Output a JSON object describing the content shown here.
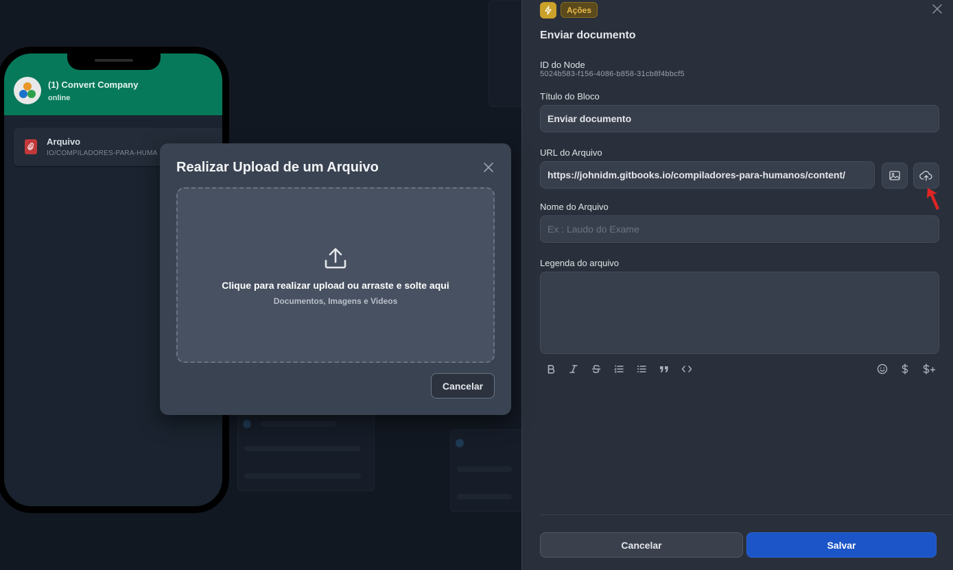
{
  "phone": {
    "contact_name": "(1) Convert Company",
    "contact_status": "online",
    "message": {
      "title": "Arquivo",
      "subtitle": "IO/COMPILADORES-PARA-HUMA"
    }
  },
  "upload_modal": {
    "title": "Realizar Upload de um Arquivo",
    "dropzone_title": "Clique para realizar upload ou arraste e solte aqui",
    "dropzone_subtitle": "Documentos, Imagens e Videos",
    "cancel_label": "Cancelar"
  },
  "panel": {
    "badge": "Ações",
    "title": "Enviar documento",
    "node_id_label": "ID do Node",
    "node_id_value": "5024b583-f156-4086-b858-31cb8f4bbcf5",
    "block_title_label": "Título do Bloco",
    "block_title_value": "Enviar documento",
    "file_url_label": "URL do Arquivo",
    "file_url_value": "https://johnidm.gitbooks.io/compiladores-para-humanos/content/",
    "file_name_label": "Nome do Arquivo",
    "file_name_placeholder": "Ex : Laudo do Exame",
    "file_caption_label": "Legenda do arquivo",
    "file_caption_value": "",
    "cancel_label": "Cancelar",
    "save_label": "Salvar",
    "toolbar": [
      "bold-icon",
      "italic-icon",
      "strikethrough-icon",
      "ordered-list-icon",
      "bullet-list-icon",
      "quote-icon",
      "code-icon",
      "emoji-icon",
      "variable-icon",
      "add-variable-icon"
    ]
  },
  "colors": {
    "whatsapp_header": "#06795a",
    "badge_accent": "#caa12a",
    "save_button": "#1b55c7",
    "annotation_arrow": "#e02424"
  }
}
